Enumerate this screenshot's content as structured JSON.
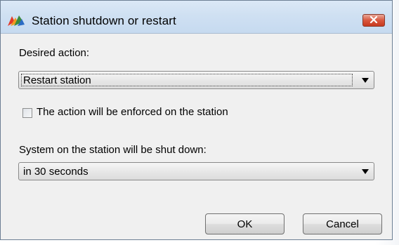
{
  "window": {
    "title": "Station shutdown or restart",
    "title_icon": "avg-logo-icon",
    "close_icon": "close-icon"
  },
  "desired_action": {
    "label": "Desired action:",
    "selected": "Restart station"
  },
  "enforce_checkbox": {
    "label": "The action will be enforced on the station",
    "checked": false
  },
  "shutdown_timing": {
    "label": "System on the station will be shut down:",
    "selected": "in 30 seconds"
  },
  "buttons": {
    "ok": "OK",
    "cancel": "Cancel"
  },
  "colors": {
    "titlebar": "#cfe0f2",
    "close_button": "#d9573e",
    "dialog_background": "#f0f0f0"
  }
}
